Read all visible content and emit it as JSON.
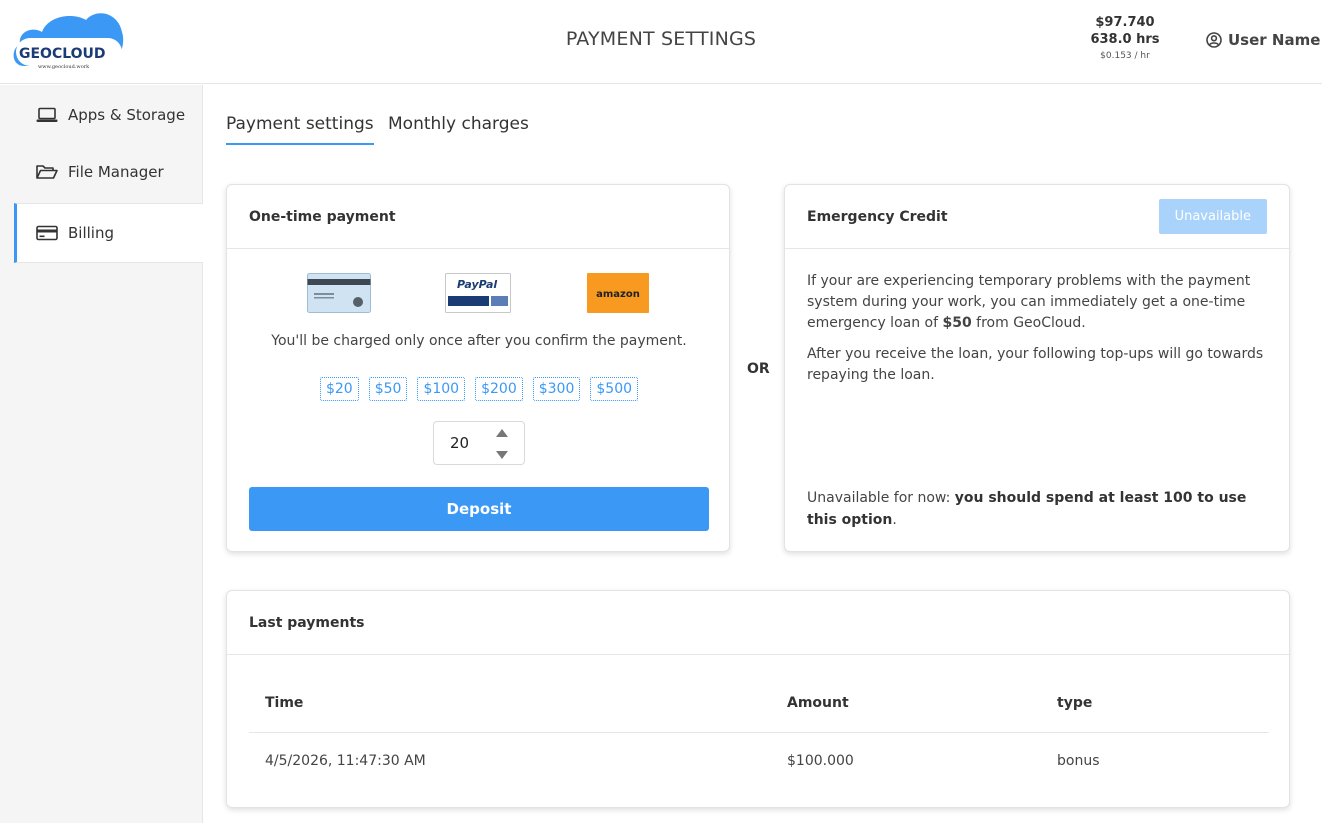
{
  "header": {
    "logo_text": "GEOCLOUD",
    "logo_url_text": "www.geocloud.work",
    "title": "PAYMENT SETTINGS",
    "balance": "$97.740",
    "hours": "638.0 hrs",
    "rate": "$0.153 / hr",
    "user_name": "User Name"
  },
  "sidebar": {
    "items": [
      {
        "label": "Apps & Storage",
        "icon": "laptop-icon"
      },
      {
        "label": "File Manager",
        "icon": "folder-open-icon"
      },
      {
        "label": "Billing",
        "icon": "credit-card-icon",
        "active": true
      }
    ]
  },
  "tabs": [
    {
      "label": "Payment settings",
      "active": true
    },
    {
      "label": "Monthly charges",
      "active": false
    }
  ],
  "one_time": {
    "title": "One-time payment",
    "methods": [
      "credit-card",
      "paypal",
      "amazon"
    ],
    "paypal_text": "PayPal",
    "amazon_text": "amazon",
    "note": "You'll be charged only once after you confirm the payment.",
    "amounts": [
      "$20",
      "$50",
      "$100",
      "$200",
      "$300",
      "$500"
    ],
    "value": "20",
    "deposit_label": "Deposit"
  },
  "or_label": "OR",
  "emergency": {
    "title": "Emergency Credit",
    "status_label": "Unavailable",
    "p1_before": "If your are experiencing temporary problems with the payment system during your work, you can immediately get a one-time emergency loan of ",
    "p1_amount": "$50",
    "p1_after": " from GeoCloud.",
    "p2": "After you receive the loan, your following top-ups will go towards repaying the loan.",
    "foot_before": "Unavailable for now: ",
    "foot_bold": "you should spend at least 100 to use this option",
    "foot_after": "."
  },
  "last_payments": {
    "title": "Last payments",
    "columns": [
      "Time",
      "Amount",
      "type"
    ],
    "rows": [
      {
        "time": "4/5/2026, 11:47:30 AM",
        "amount": "$100.000",
        "type": "bonus"
      }
    ]
  },
  "colors": {
    "accent": "#3b99f5",
    "disabled_button": "#a9d3fb",
    "amazon": "#f79a1f",
    "paypal_navy": "#1b3b74"
  }
}
